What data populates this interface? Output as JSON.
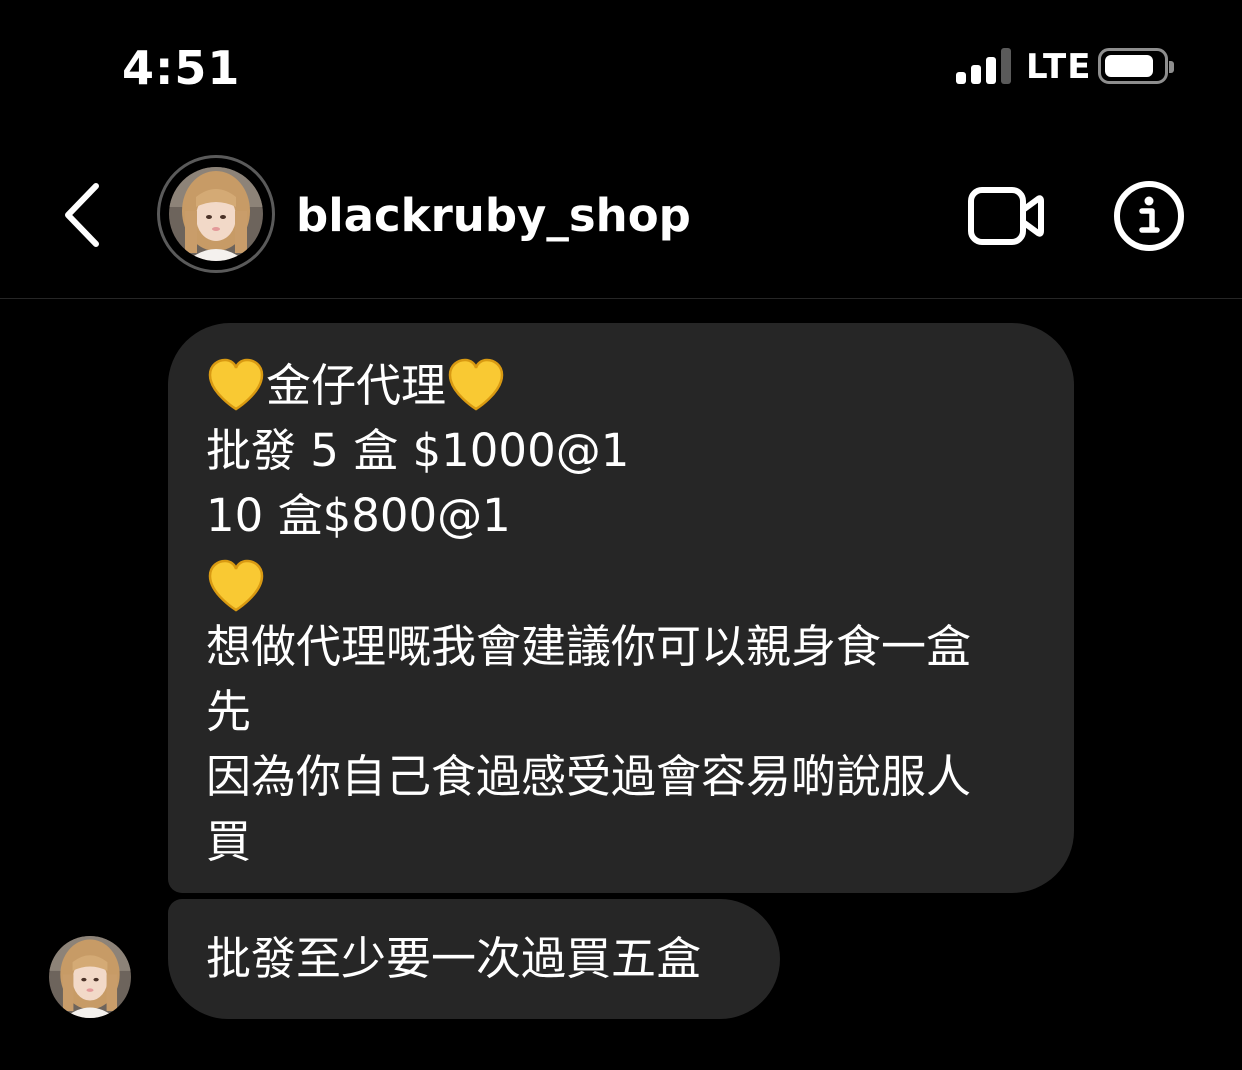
{
  "status_bar": {
    "time": "4:51",
    "carrier": "LTE",
    "signal_bars": 3,
    "signal_bars_total": 4,
    "battery_level": 0.8
  },
  "header": {
    "username": "blackruby_shop",
    "back_icon": "chevron-left-icon",
    "video_icon": "video-camera-icon",
    "info_icon": "info-icon",
    "avatar_icon": "profile-photo"
  },
  "messages": [
    {
      "lines": {
        "l1": "金仔代理",
        "l2": "批發 5 盒 $1000@1",
        "l3": "10 盒$800@1",
        "l4": "想做代理嘅我會建議你可以親身食一盒",
        "l5": "先",
        "l6": "因為你自己食過感受過會容易啲說服人",
        "l7": "買"
      },
      "emoji": "yellow-heart"
    },
    {
      "text": "批發至少要一次過買五盒"
    }
  ],
  "colors": {
    "background": "#000000",
    "bubble": "#262626",
    "text": "#ffffff",
    "heart": "#f9c933"
  }
}
